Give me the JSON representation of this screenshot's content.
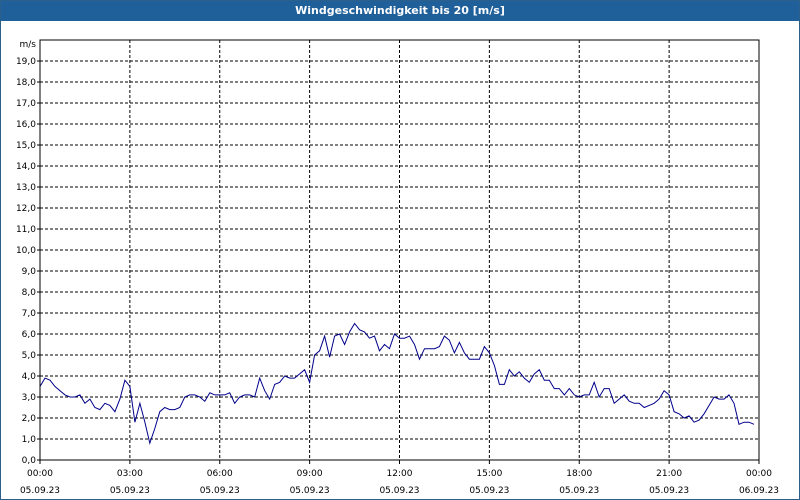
{
  "title": "Windgeschwindigkeit bis 20 [m/s]",
  "chart_data": {
    "type": "line",
    "title": "Windgeschwindigkeit bis 20 [m/s]",
    "ylabel": "m/s",
    "ylim": [
      0,
      20
    ],
    "yticks": [
      "0,0",
      "1,0",
      "2,0",
      "3,0",
      "4,0",
      "5,0",
      "6,0",
      "7,0",
      "8,0",
      "9,0",
      "10,0",
      "11,0",
      "12,0",
      "13,0",
      "14,0",
      "15,0",
      "16,0",
      "17,0",
      "18,0",
      "19,0"
    ],
    "xlim_hours": [
      0,
      24
    ],
    "xticks": [
      {
        "time": "00:00",
        "date": "05.09.23"
      },
      {
        "time": "03:00",
        "date": "05.09.23"
      },
      {
        "time": "06:00",
        "date": "05.09.23"
      },
      {
        "time": "09:00",
        "date": "05.09.23"
      },
      {
        "time": "12:00",
        "date": "05.09.23"
      },
      {
        "time": "15:00",
        "date": "05.09.23"
      },
      {
        "time": "18:00",
        "date": "05.09.23"
      },
      {
        "time": "21:00",
        "date": "05.09.23"
      },
      {
        "time": "00:00",
        "date": "06.09.23"
      }
    ],
    "grid": true,
    "series": [
      {
        "color": "#00008b",
        "x": [
          "05.09.23 00:00",
          "05.09.23 00:10",
          "05.09.23 00:20",
          "05.09.23 00:30",
          "05.09.23 00:40",
          "05.09.23 00:50",
          "05.09.23 01:00",
          "05.09.23 01:10",
          "05.09.23 01:20",
          "05.09.23 01:30",
          "05.09.23 01:40",
          "05.09.23 01:50",
          "05.09.23 02:00",
          "05.09.23 02:10",
          "05.09.23 02:20",
          "05.09.23 02:30",
          "05.09.23 02:40",
          "05.09.23 02:50",
          "05.09.23 03:00",
          "05.09.23 03:10",
          "05.09.23 03:20",
          "05.09.23 03:30",
          "05.09.23 03:40",
          "05.09.23 03:50",
          "05.09.23 04:00",
          "05.09.23 04:10",
          "05.09.23 04:20",
          "05.09.23 04:30",
          "05.09.23 04:40",
          "05.09.23 04:50",
          "05.09.23 05:00",
          "05.09.23 05:10",
          "05.09.23 05:20",
          "05.09.23 05:30",
          "05.09.23 05:40",
          "05.09.23 05:50",
          "05.09.23 06:00",
          "05.09.23 06:10",
          "05.09.23 06:20",
          "05.09.23 06:30",
          "05.09.23 06:40",
          "05.09.23 06:50",
          "05.09.23 07:00",
          "05.09.23 07:10",
          "05.09.23 07:20",
          "05.09.23 07:30",
          "05.09.23 07:40",
          "05.09.23 07:50",
          "05.09.23 08:00",
          "05.09.23 08:10",
          "05.09.23 08:20",
          "05.09.23 08:30",
          "05.09.23 08:40",
          "05.09.23 08:50",
          "05.09.23 09:00",
          "05.09.23 09:10",
          "05.09.23 09:20",
          "05.09.23 09:30",
          "05.09.23 09:40",
          "05.09.23 09:50",
          "05.09.23 10:00",
          "05.09.23 10:10",
          "05.09.23 10:20",
          "05.09.23 10:30",
          "05.09.23 10:40",
          "05.09.23 10:50",
          "05.09.23 11:00",
          "05.09.23 11:10",
          "05.09.23 11:20",
          "05.09.23 11:30",
          "05.09.23 11:40",
          "05.09.23 11:50",
          "05.09.23 12:00",
          "05.09.23 12:10",
          "05.09.23 12:20",
          "05.09.23 12:30",
          "05.09.23 12:40",
          "05.09.23 12:50",
          "05.09.23 13:00",
          "05.09.23 13:10",
          "05.09.23 13:20",
          "05.09.23 13:30",
          "05.09.23 13:40",
          "05.09.23 13:50",
          "05.09.23 14:00",
          "05.09.23 14:10",
          "05.09.23 14:20",
          "05.09.23 14:30",
          "05.09.23 14:40",
          "05.09.23 14:50",
          "05.09.23 15:00",
          "05.09.23 15:10",
          "05.09.23 15:20",
          "05.09.23 15:30",
          "05.09.23 15:40",
          "05.09.23 15:50",
          "05.09.23 16:00",
          "05.09.23 16:10",
          "05.09.23 16:20",
          "05.09.23 16:30",
          "05.09.23 16:40",
          "05.09.23 16:50",
          "05.09.23 17:00",
          "05.09.23 17:10",
          "05.09.23 17:20",
          "05.09.23 17:30",
          "05.09.23 17:40",
          "05.09.23 17:50",
          "05.09.23 18:00",
          "05.09.23 18:10",
          "05.09.23 18:20",
          "05.09.23 18:30",
          "05.09.23 18:40",
          "05.09.23 18:50",
          "05.09.23 19:00",
          "05.09.23 19:10",
          "05.09.23 19:20",
          "05.09.23 19:30",
          "05.09.23 19:40",
          "05.09.23 19:50",
          "05.09.23 20:00",
          "05.09.23 20:10",
          "05.09.23 20:20",
          "05.09.23 20:30",
          "05.09.23 20:40",
          "05.09.23 20:50",
          "05.09.23 21:00",
          "05.09.23 21:10",
          "05.09.23 21:20",
          "05.09.23 21:30",
          "05.09.23 21:40",
          "05.09.23 21:50",
          "05.09.23 22:00",
          "05.09.23 22:10",
          "05.09.23 22:20",
          "05.09.23 22:30",
          "05.09.23 22:40",
          "05.09.23 22:50",
          "05.09.23 23:00",
          "05.09.23 23:10",
          "05.09.23 23:20",
          "05.09.23 23:30",
          "05.09.23 23:40",
          "05.09.23 23:50"
        ],
        "y": [
          3.5,
          3.9,
          3.8,
          3.5,
          3.3,
          3.1,
          3.0,
          3.0,
          3.1,
          2.7,
          2.9,
          2.5,
          2.4,
          2.7,
          2.6,
          2.3,
          2.9,
          3.8,
          3.5,
          1.8,
          2.7,
          1.8,
          0.8,
          1.5,
          2.3,
          2.5,
          2.4,
          2.4,
          2.5,
          3.0,
          3.1,
          3.1,
          3.0,
          2.8,
          3.2,
          3.1,
          3.1,
          3.1,
          3.2,
          2.7,
          3.0,
          3.1,
          3.1,
          3.0,
          3.9,
          3.3,
          2.9,
          3.6,
          3.7,
          4.0,
          3.9,
          3.9,
          4.1,
          4.3,
          3.7,
          5.0,
          5.2,
          5.9,
          4.9,
          5.9,
          6.0,
          5.5,
          6.1,
          6.5,
          6.2,
          6.1,
          5.8,
          5.9,
          5.2,
          5.5,
          5.3,
          6.0,
          5.8,
          5.8,
          5.9,
          5.5,
          4.8,
          5.3,
          5.3,
          5.3,
          5.4,
          5.9,
          5.7,
          5.1,
          5.6,
          5.1,
          4.8,
          4.8,
          4.8,
          5.4,
          5.1,
          4.5,
          3.6,
          3.6,
          4.3,
          4.0,
          4.2,
          3.9,
          3.7,
          4.1,
          4.3,
          3.8,
          3.8,
          3.4,
          3.4,
          3.1,
          3.4,
          3.1,
          3.0,
          3.1,
          3.1,
          3.7,
          3.0,
          3.4,
          3.4,
          2.7,
          2.9,
          3.1,
          2.8,
          2.7,
          2.7,
          2.5,
          2.6,
          2.7,
          2.9,
          3.3,
          3.1,
          2.3,
          2.2,
          2.0,
          2.1,
          1.8,
          1.9,
          2.2,
          2.6,
          3.0,
          2.9,
          2.9,
          3.1,
          2.7,
          1.7,
          1.8,
          1.8,
          1.7
        ]
      }
    ]
  }
}
